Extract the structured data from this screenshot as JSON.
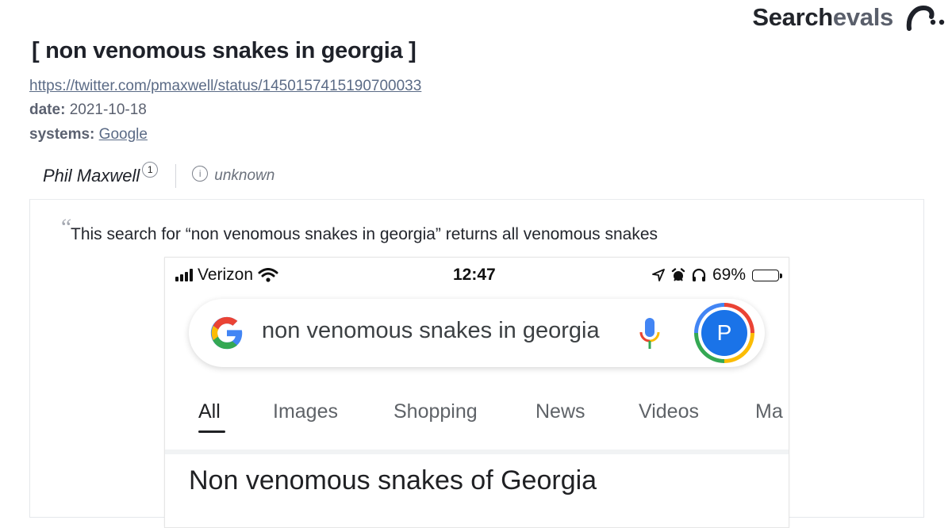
{
  "brand": {
    "part1": "Search",
    "part2": "evals",
    "logo_icon": "searchevals-logo-icon"
  },
  "page": {
    "title": "non venomous snakes in georgia",
    "bracket_open": "[",
    "bracket_close": "]",
    "link": "https://twitter.com/pmaxwell/status/1450157415190700033",
    "date_label": "date:",
    "date_value": "2021-10-18",
    "systems_label": "systems:",
    "systems_value": "Google"
  },
  "author": {
    "name": "Phil Maxwell",
    "badge": "1",
    "info_icon": "info-icon",
    "status": "unknown"
  },
  "quote": {
    "mark": "“",
    "text": "This search for “non venomous snakes in georgia” returns all venomous snakes"
  },
  "screenshot": {
    "status_bar": {
      "carrier": "Verizon",
      "time": "12:47",
      "battery": "69%",
      "battery_level": 0.69,
      "icons": [
        "signal-icon",
        "wifi-icon",
        "location-icon",
        "alarm-icon",
        "headphones-icon",
        "battery-icon"
      ]
    },
    "search": {
      "query": "non venomous snakes in georgia",
      "avatar_letter": "P"
    },
    "tabs": [
      "All",
      "Images",
      "Shopping",
      "News",
      "Videos",
      "Ma"
    ],
    "active_tab": "All",
    "result_title": "Non venomous snakes of Georgia",
    "colors": {
      "google_blue": "#4285f4",
      "google_red": "#ea4335",
      "google_yellow": "#fbbc05",
      "google_green": "#34a853",
      "avatar_bg": "#1a73e8"
    }
  }
}
